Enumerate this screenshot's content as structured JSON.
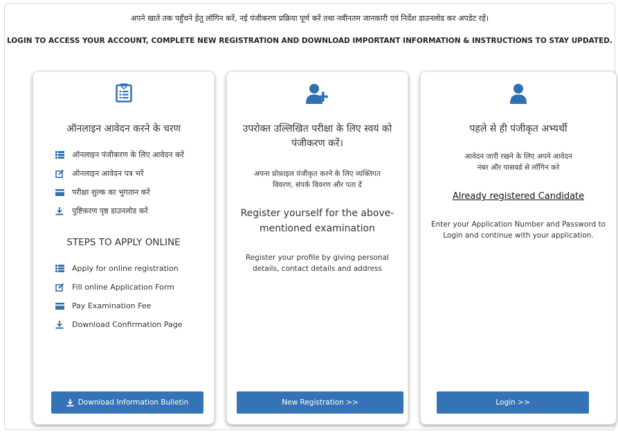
{
  "header": {
    "hindi": "अपने खाते तक पहुँचने हेतु लॉगिन करें, नई पंजीकरण प्रक्रिया पूर्ण करें तथा नवीनतम जानकारी एवं निर्देश डाउनलोड कर अपडेट रहें।",
    "english": "LOGIN TO ACCESS YOUR ACCOUNT, COMPLETE NEW REGISTRATION AND DOWNLOAD IMPORTANT INFORMATION & INSTRUCTIONS TO STAY UPDATED."
  },
  "card1": {
    "icon": "form-document-icon",
    "title": "ऑनलाइन आवेदन करने के चरण",
    "steps_hi": [
      {
        "icon": "list-icon",
        "label": "ऑनलाइन पंजीकरण के लिए आवेदन करें"
      },
      {
        "icon": "edit-icon",
        "label": "ऑनलाइन आवेदन पत्र भरें"
      },
      {
        "icon": "card-icon",
        "label": "परीक्षा शुल्क का भुगतान करें"
      },
      {
        "icon": "download-icon",
        "label": "पुष्टिकरण पृष्ठ डाउनलोड करें"
      }
    ],
    "subtitle": "STEPS TO APPLY ONLINE",
    "steps_en": [
      {
        "icon": "list-icon",
        "label": "Apply for online registration"
      },
      {
        "icon": "edit-icon",
        "label": "Fill online Application Form"
      },
      {
        "icon": "card-icon",
        "label": "Pay Examination Fee"
      },
      {
        "icon": "download-icon",
        "label": "Download Confirmation Page"
      }
    ],
    "button": "Download Information Bulletin"
  },
  "card2": {
    "icon": "add-user-icon",
    "title_line1": "उपरोक्त उल्लिखित परीक्षा के लिए स्वयं को",
    "title_line2": "पंजीकरण करें।",
    "desc_hi_line1": "अपना प्रोफ़ाइल पंजीकृत करने के लिए व्यक्तिगत",
    "desc_hi_line2": "विवरण, संपर्क विवरण और पता दें",
    "title_en_line1": "Register yourself for the above-",
    "title_en_line2": "mentioned examination",
    "desc_en_line1": "Register your profile by giving personal",
    "desc_en_line2": "details, contact details and address",
    "button": "New Registration >>"
  },
  "card3": {
    "icon": "user-icon",
    "title": "पहले से ही पंजीकृत अभ्यर्थी",
    "desc_hi_line1": "आवेदन जारी रखने के लिए अपने आवेदन",
    "desc_hi_line2": "नंबर और पासवर्ड से लॉगिन करे",
    "link": "Already registered Candidate",
    "desc_en_line1": "Enter your Application Number and Password to",
    "desc_en_line2": "Login and continue with your application.",
    "button": "Login >>"
  },
  "colors": {
    "accent": "#3474b6",
    "icon": "#2f6fb2"
  }
}
